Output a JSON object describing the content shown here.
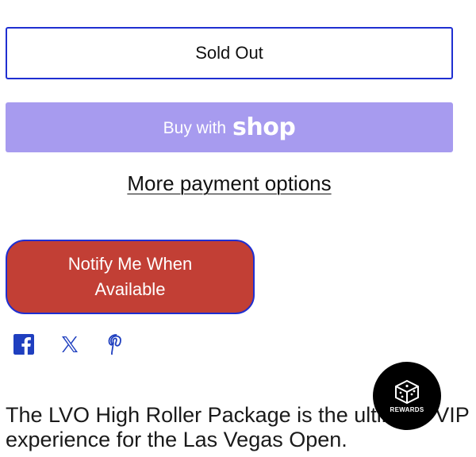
{
  "product_form": {
    "sold_out_label": "Sold Out",
    "shop_pay": {
      "prefix": "Buy with",
      "brand": "shop"
    },
    "more_payment_label": "More payment options",
    "notify_label": "Notify Me When Available"
  },
  "share_icons": [
    "facebook-icon",
    "x-icon",
    "pinterest-icon"
  ],
  "description": {
    "text": "The LVO High Roller Package is the ultimate VIP experience for the Las Vegas Open."
  },
  "rewards_widget": {
    "label": "REWARDS"
  },
  "colors": {
    "accent_border": "#1f2fd1",
    "shop_pay_bg": "#a79bef",
    "notify_bg": "#c23f35",
    "icon_blue": "#1f3fbf"
  }
}
